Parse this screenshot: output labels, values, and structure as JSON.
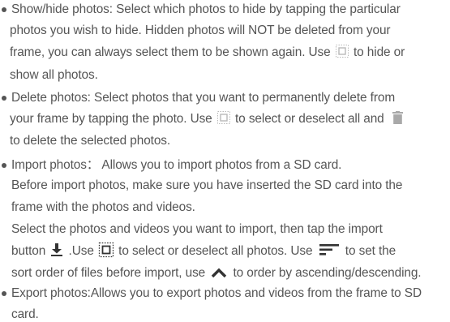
{
  "sections": [
    {
      "lines": [
        "Show/hide photos: Select which photos to hide by tapping the particular",
        "photos you wish to hide. Hidden photos will NOT be deleted from your",
        [
          "frame, you can always select them to be shown again. Use ",
          " to hide or"
        ],
        "show all photos."
      ]
    },
    {
      "lines": [
        "Delete photos: Select photos that you want to permanently delete from",
        [
          "your frame by tapping the photo. Use ",
          " to select or deselect all and "
        ],
        "to delete the selected photos."
      ]
    },
    {
      "lines": [
        "Import photos： Allows you to import photos from a SD card.",
        "Before import photos, make sure you have inserted the SD card into the",
        "frame with the photos and videos.",
        "Select the photos and videos you want to import, then tap the import",
        [
          "button ",
          " .Use ",
          " to select or deselect all photos. Use ",
          " to set the"
        ],
        [
          "sort order of files before import, use ",
          " to order by ascending/descending."
        ]
      ]
    },
    {
      "lines": [
        "Export photos:Allows you to export photos and videos from the frame to SD",
        "card."
      ]
    }
  ],
  "icons": {
    "select_all_faint": "select-all-icon",
    "trash": "trash-icon",
    "download": "download-icon",
    "select_all": "select-all-icon",
    "sort": "sort-icon",
    "chevron_up": "chevron-up-icon"
  },
  "colors": {
    "text": "#555555",
    "icon_faint": "#b9b9b9",
    "icon_dark": "#333333"
  }
}
